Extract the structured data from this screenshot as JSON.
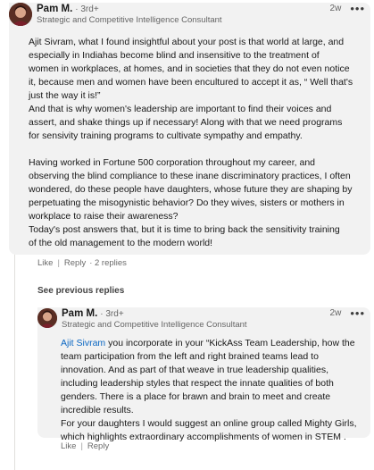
{
  "comment1": {
    "author": "Pam M.",
    "degree": "· 3rd+",
    "headline": "Strategic and Competitive Intelligence Consultant",
    "time": "2w",
    "more": "•••",
    "paragraph1": "Ajit Sivram, what I found insightful about your post is that world at large, and\nespecially in Indiahas become blind and insensitive to the treatment of\nwomen in workplaces, at homes, and in societies that they do not even notice\nit, because men and women have been encultured to accept it as, “ Well that's\njust the way it is!”\nAnd that is why women's leadership are important to find their voices and\nassert, and shake things up if necessary! Along with that we need programs\nfor sensivity training programs to cultivate sympathy and empathy.",
    "paragraph2": "Having worked in Fortune 500 corporation throughout my career, and\nobserving the blind compliance to these inane discriminatory practices, I often\nwondered, do these people have daughters, whose future they are shaping by\nperpetuating the misogynistic behavior? Do they wives, sisters or mothers in\nworkplace to raise their awareness?\nToday's post answers that, but it is time to bring back the sensitivity training\nof the old management to the modern world!",
    "like": "Like",
    "reply": "Reply",
    "replies": "· 2 replies"
  },
  "see_previous": "See previous replies",
  "comment2": {
    "author": "Pam M.",
    "degree": "· 3rd+",
    "headline": "Strategic and Competitive Intelligence Consultant",
    "time": "2w",
    "more": "•••",
    "mention": "Ajit Sivram",
    "paragraph1_rest": " you incorporate in your “KickAss Team Leadership, how the\nteam participation from the left and right brained teams lead to\ninnovation. And as part of that weave in true leadership qualities,\nincluding leadership styles that respect the innate qualities of both\ngenders. There is a place for brawn and brain to meet and create\nincredible results.\nFor your daughters I would suggest an online group called Mighty Girls,\nwhich highlights extraordinary accomplishments of women in STEM .",
    "like": "Like",
    "reply": "Reply"
  }
}
